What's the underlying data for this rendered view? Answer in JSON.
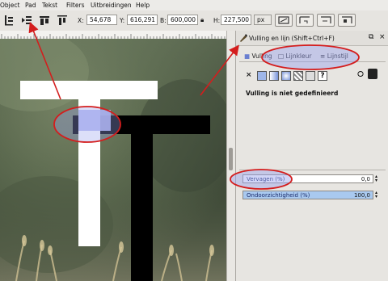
{
  "menu": [
    "Object",
    "Pad",
    "Tekst",
    "Filters",
    "Uitbreidingen",
    "Help"
  ],
  "toolbar": {
    "x_label": "X:",
    "x_value": "54,678",
    "y_label": "Y:",
    "y_value": "616,291",
    "w_label": "B:",
    "w_value": "600,000",
    "h_label": "H:",
    "h_value": "227,500",
    "unit": "px"
  },
  "panel": {
    "title": "Vulling en lijn (Shift+Ctrl+F)",
    "tabs": [
      "Vulling",
      "Lijnkleur",
      "Lijnstijl"
    ],
    "no_fill_text": "Vulling is niet gedefinieerd",
    "blur_label": "Vervagen (%)",
    "blur_value": "0,0",
    "opacity_label": "Ondoorzichtigheid (%)",
    "opacity_value": "100,0"
  },
  "colors": {
    "annotation": "#d41d1d",
    "highlight": "#9aa2ee",
    "opacity_bar": "#a9c9ef"
  }
}
